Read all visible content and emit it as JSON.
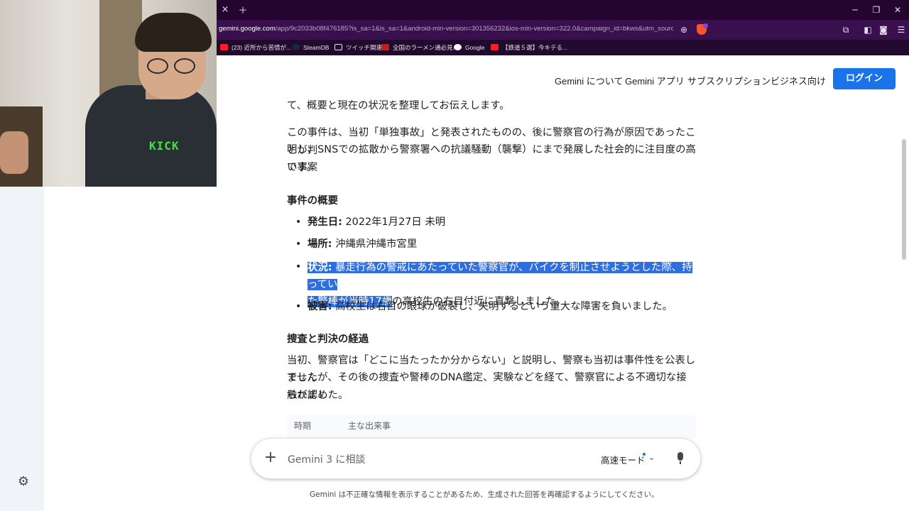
{
  "browser": {
    "tab_close_glyph": "×",
    "new_tab_glyph": "+",
    "window_controls": [
      "─",
      "❐",
      "✕"
    ],
    "url_host": "gemini.google.com",
    "url_rest": "/app/9c2033b08f476185?is_sa=1&is_sa=1&android-min-version=301356232&ios-min-version=322.0&campaign_id=bkws&utm_sourc...",
    "bookmarks": [
      {
        "label": "(23) 近所から苦情が...",
        "icon": "youtube-icon"
      },
      {
        "label": "SteamDB",
        "icon": "steam-icon"
      },
      {
        "label": "ツイッチ関連",
        "icon": "folder-icon"
      },
      {
        "label": "全国のラーメン通必見...",
        "icon": "ramen-icon"
      },
      {
        "label": "Google",
        "icon": "google-icon"
      },
      {
        "label": "【鉄道５選】今キテる...",
        "icon": "youtube-icon"
      }
    ]
  },
  "nav": {
    "links": [
      "Gemini について",
      "Gemini アプリ",
      "サブスクリプション",
      "ビジネス向け"
    ],
    "login": "ログイン"
  },
  "content": {
    "intro_tail": "て、概要と現在の状況を整理してお伝えします。",
    "summary": [
      "この事件は、当初「単独事故」と発表されたものの、後に警察官の行為が原因であったことが判",
      "明し、SNSでの拡散から警察署への抗議騒動（襲撃）にまで発展した社会的に注目度の高い事案",
      "です。"
    ],
    "overview_heading": "事件の概要",
    "bullets": [
      {
        "label": "発生日:",
        "text": " 2022年1月27日 未明"
      },
      {
        "label": "場所:",
        "text": " 沖縄県沖縄市宮里"
      },
      {
        "label": "状況:",
        "text_hl_1": " 暴走行為の警戒にあたっていた警察官が、バイクを制止させようとした際、持ってい",
        "text_hl_2": "た警棒が当時17歳",
        "text_rest": "の高校生の右目付近に直撃しました。"
      },
      {
        "label": "被害:",
        "text": " 高校生は右目の眼球が破裂し、失明するという重大な障害を負いました。"
      }
    ],
    "investigation_heading": "捜査と判決の経過",
    "investigation": [
      "当初、警察官は「どこに当たったか分からない」と説明し、警察も当初は事件性を公表しません",
      "でしたが、その後の捜査や警棒のDNA鑑定、実験などを経て、警察官による不適切な接触が認め",
      "られました。"
    ],
    "table_headers": [
      "時期",
      "主な出来事"
    ]
  },
  "prompt": {
    "placeholder": "Gemini 3 に相談",
    "mode": "高速モード",
    "plus_glyph": "+",
    "chevron_glyph": "⌄"
  },
  "disclaimer": "Gemini は不正確な情報を表示することがあるため、生成された回答を再確認するようにしてください。",
  "webcam": {
    "shirt_text": "KICK"
  },
  "colors": {
    "accent": "#1a73e8",
    "highlight": "#2d6ee0",
    "tabbar": "#23052e",
    "addressbar": "#3a0f4d"
  }
}
